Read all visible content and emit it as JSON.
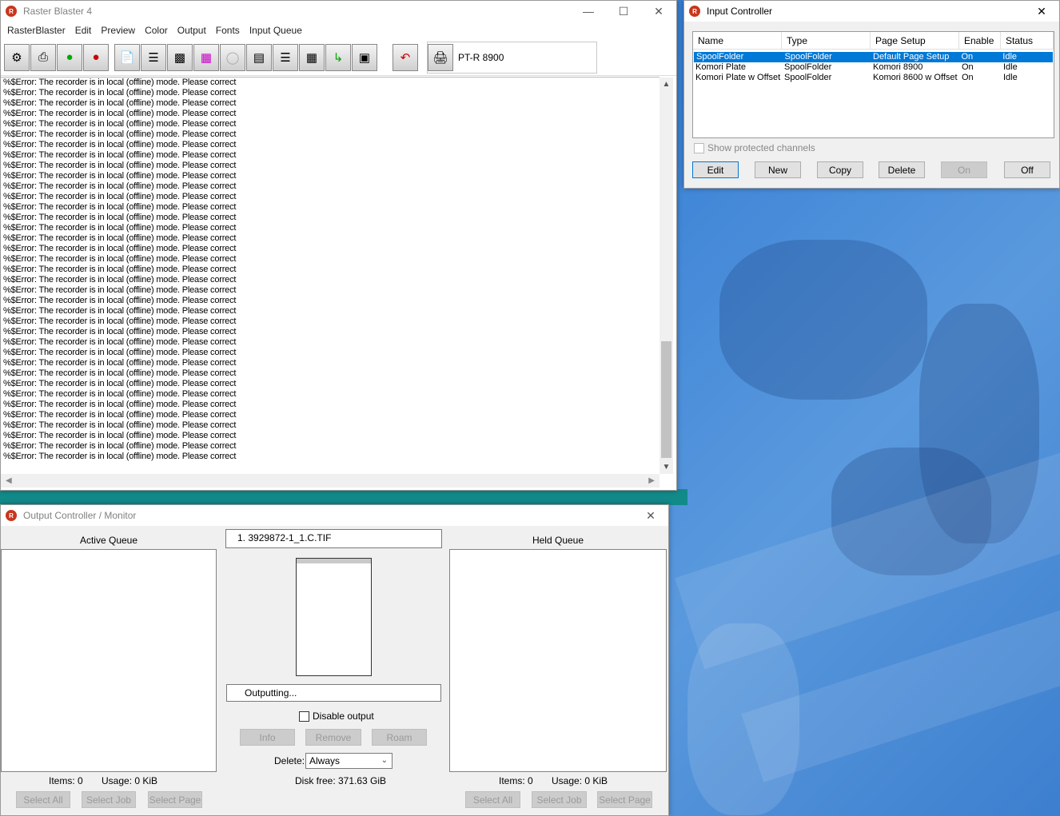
{
  "main_window": {
    "title": "Raster Blaster 4",
    "menu": [
      "RasterBlaster",
      "Edit",
      "Preview",
      "Color",
      "Output",
      "Fonts",
      "Input Queue"
    ],
    "printer_name": "PT-R 8900",
    "log_line": "%$Error: The recorder is in local (offline) mode. Please correct",
    "log_line_count": 37
  },
  "input_controller": {
    "title": "Input Controller",
    "columns": [
      "Name",
      "Type",
      "Page Setup",
      "Enable",
      "Status"
    ],
    "rows": [
      [
        "SpoolFolder",
        "SpoolFolder",
        "Default Page Setup",
        "On",
        "Idle"
      ],
      [
        "Komori Plate",
        "SpoolFolder",
        "Komori 8900",
        "On",
        "Idle"
      ],
      [
        "Komori Plate w Offset",
        "SpoolFolder",
        "Komori 8600 w Offset",
        "On",
        "Idle"
      ]
    ],
    "show_protected_label": "Show protected channels",
    "buttons": {
      "edit": "Edit",
      "new": "New",
      "copy": "Copy",
      "delete": "Delete",
      "on": "On",
      "off": "Off"
    }
  },
  "output_controller": {
    "title": "Output Controller / Monitor",
    "active_queue_label": "Active Queue",
    "held_queue_label": "Held Queue",
    "current_file": "1. 3929872-1_1.C.TIF",
    "status": "Outputting...",
    "disable_output_label": "Disable output",
    "info_button": "Info",
    "remove_button": "Remove",
    "roam_button": "Roam",
    "delete_label": "Delete:",
    "delete_value": "Always",
    "disk_free": "Disk free: 371.63 GiB",
    "active": {
      "items": "Items: 0",
      "usage": "Usage: 0 KiB"
    },
    "held": {
      "items": "Items: 0",
      "usage": "Usage: 0 KiB"
    },
    "select_all": "Select All",
    "select_job": "Select Job",
    "select_page": "Select Page"
  },
  "icons": {
    "app": "rb-logo-icon",
    "minimize": "minimize-icon",
    "maximize": "maximize-icon",
    "close": "close-icon"
  }
}
